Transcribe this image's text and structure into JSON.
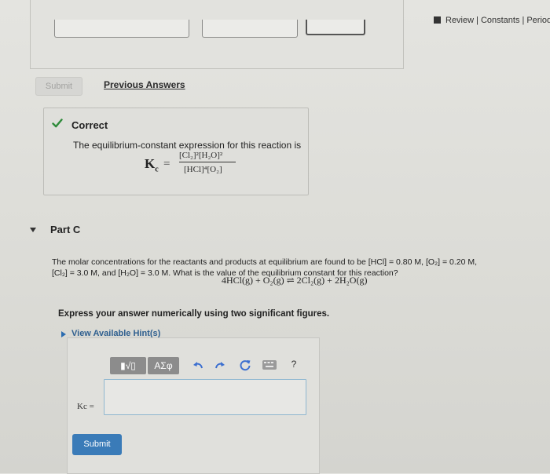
{
  "header": {
    "links": [
      "Review",
      "Constants",
      "Periodic"
    ]
  },
  "prev_part": {
    "submit_label": "Submit",
    "previous_answers_label": "Previous Answers"
  },
  "feedback": {
    "status": "Correct",
    "text": "The equilibrium-constant expression for this reaction is",
    "lhs": "K",
    "lhs_sub": "c",
    "numerator": "[Cl₂]²[H₂O]²",
    "denominator": "[HCl]⁴[O₂]"
  },
  "part": {
    "title": "Part C",
    "question_line1": "The molar concentrations for the reactants and products at equilibrium are found to be [HCl] = 0.80 M, [O₂] = 0.20 M,",
    "question_line2": "[Cl₂] = 3.0 M, and [H₂O] = 3.0 M. What is the value of the equilibrium constant for this reaction?",
    "reaction": "4HCl(g) + O₂(g) ⇌ 2Cl₂(g) + 2H₂O(g)",
    "instruction": "Express your answer numerically using two significant figures.",
    "hint_label": "View Available Hint(s)"
  },
  "answer": {
    "toolbar": {
      "template_label": "▮√▯",
      "symbols_label": "ΑΣφ",
      "help_label": "?"
    },
    "label": "Kc =",
    "value": "",
    "submit_label": "Submit"
  },
  "colors": {
    "accent": "#3a7bb8",
    "check": "#2e8b3a",
    "toolbar_icon": "#3b6fd0"
  }
}
